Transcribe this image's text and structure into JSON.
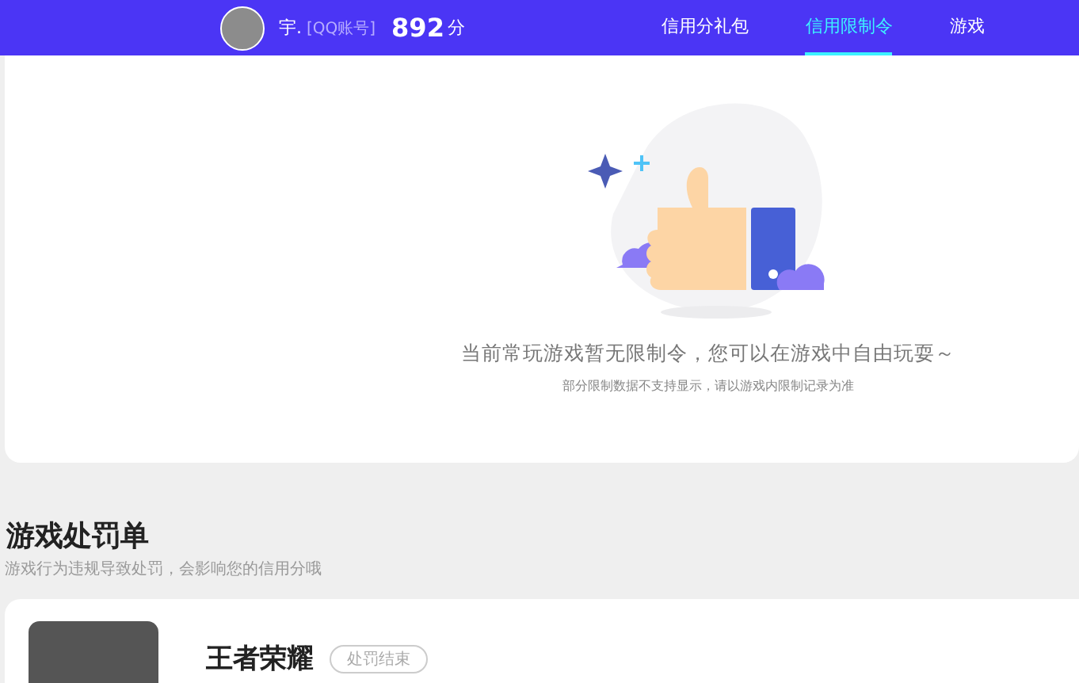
{
  "header": {
    "user_name": "宇.",
    "account_type": "[QQ账号]",
    "score": "892",
    "score_unit": "分",
    "tabs": [
      {
        "label": "信用分礼包",
        "selected": false
      },
      {
        "label": "信用限制令",
        "selected": true
      },
      {
        "label": "游戏",
        "selected": false
      }
    ]
  },
  "restriction_card": {
    "message": "当前常玩游戏暂无限制令，您可以在游戏中自由玩耍～",
    "note": "部分限制数据不支持显示，请以游戏内限制记录为准"
  },
  "penalty_section": {
    "title": "游戏处罚单",
    "subtitle": "游戏行为违规导致处罚，会影响您的信用分哦",
    "items": [
      {
        "game": "王者荣耀",
        "status": "处罚结束"
      }
    ]
  }
}
